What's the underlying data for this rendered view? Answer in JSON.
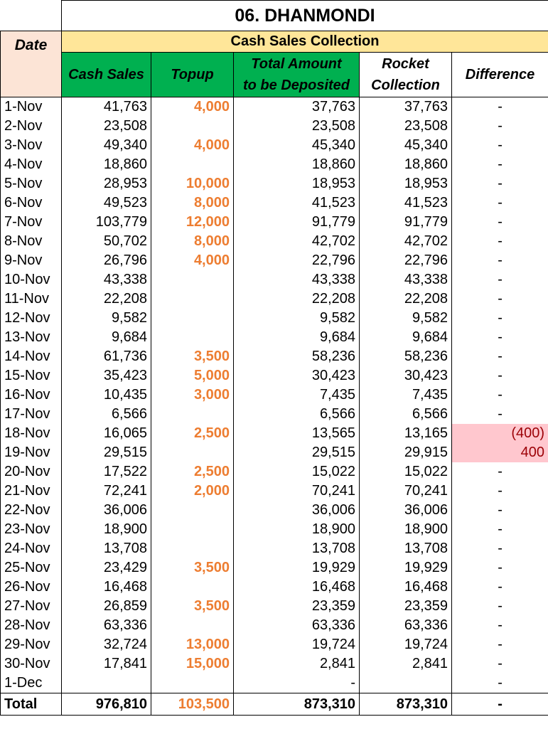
{
  "title": "06. DHANMONDI",
  "section_title": "Cash Sales Collection",
  "headers": {
    "date": "Date",
    "cash_sales": "Cash Sales",
    "topup": "Topup",
    "total_amount_line1": "Total Amount",
    "total_amount_line2": "to be Deposited",
    "rocket_line1": "Rocket",
    "rocket_line2": "Collection",
    "difference": "Difference"
  },
  "colors": {
    "banner": "#ffe699",
    "green_header": "#00b050",
    "date_header": "#fce4d6",
    "topup_text": "#ed7d31",
    "diff_highlight_bg": "#ffc7ce",
    "diff_highlight_text": "#9c0006"
  },
  "rows": [
    {
      "date": "1-Nov",
      "cash_sales": "41,763",
      "topup": "4,000",
      "total": "37,763",
      "rocket": "37,763",
      "difference": "-"
    },
    {
      "date": "2-Nov",
      "cash_sales": "23,508",
      "topup": "",
      "total": "23,508",
      "rocket": "23,508",
      "difference": "-"
    },
    {
      "date": "3-Nov",
      "cash_sales": "49,340",
      "topup": "4,000",
      "total": "45,340",
      "rocket": "45,340",
      "difference": "-"
    },
    {
      "date": "4-Nov",
      "cash_sales": "18,860",
      "topup": "",
      "total": "18,860",
      "rocket": "18,860",
      "difference": "-"
    },
    {
      "date": "5-Nov",
      "cash_sales": "28,953",
      "topup": "10,000",
      "total": "18,953",
      "rocket": "18,953",
      "difference": "-"
    },
    {
      "date": "6-Nov",
      "cash_sales": "49,523",
      "topup": "8,000",
      "total": "41,523",
      "rocket": "41,523",
      "difference": "-"
    },
    {
      "date": "7-Nov",
      "cash_sales": "103,779",
      "topup": "12,000",
      "total": "91,779",
      "rocket": "91,779",
      "difference": "-"
    },
    {
      "date": "8-Nov",
      "cash_sales": "50,702",
      "topup": "8,000",
      "total": "42,702",
      "rocket": "42,702",
      "difference": "-"
    },
    {
      "date": "9-Nov",
      "cash_sales": "26,796",
      "topup": "4,000",
      "total": "22,796",
      "rocket": "22,796",
      "difference": "-"
    },
    {
      "date": "10-Nov",
      "cash_sales": "43,338",
      "topup": "",
      "total": "43,338",
      "rocket": "43,338",
      "difference": "-"
    },
    {
      "date": "11-Nov",
      "cash_sales": "22,208",
      "topup": "",
      "total": "22,208",
      "rocket": "22,208",
      "difference": "-"
    },
    {
      "date": "12-Nov",
      "cash_sales": "9,582",
      "topup": "",
      "total": "9,582",
      "rocket": "9,582",
      "difference": "-"
    },
    {
      "date": "13-Nov",
      "cash_sales": "9,684",
      "topup": "",
      "total": "9,684",
      "rocket": "9,684",
      "difference": "-"
    },
    {
      "date": "14-Nov",
      "cash_sales": "61,736",
      "topup": "3,500",
      "total": "58,236",
      "rocket": "58,236",
      "difference": "-"
    },
    {
      "date": "15-Nov",
      "cash_sales": "35,423",
      "topup": "5,000",
      "total": "30,423",
      "rocket": "30,423",
      "difference": "-"
    },
    {
      "date": "16-Nov",
      "cash_sales": "10,435",
      "topup": "3,000",
      "total": "7,435",
      "rocket": "7,435",
      "difference": "-"
    },
    {
      "date": "17-Nov",
      "cash_sales": "6,566",
      "topup": "",
      "total": "6,566",
      "rocket": "6,566",
      "difference": "-"
    },
    {
      "date": "18-Nov",
      "cash_sales": "16,065",
      "topup": "2,500",
      "total": "13,565",
      "rocket": "13,165",
      "difference": "(400)",
      "flag": "neg"
    },
    {
      "date": "19-Nov",
      "cash_sales": "29,515",
      "topup": "",
      "total": "29,515",
      "rocket": "29,915",
      "difference": "400",
      "flag": "pos"
    },
    {
      "date": "20-Nov",
      "cash_sales": "17,522",
      "topup": "2,500",
      "total": "15,022",
      "rocket": "15,022",
      "difference": "-"
    },
    {
      "date": "21-Nov",
      "cash_sales": "72,241",
      "topup": "2,000",
      "total": "70,241",
      "rocket": "70,241",
      "difference": "-"
    },
    {
      "date": "22-Nov",
      "cash_sales": "36,006",
      "topup": "",
      "total": "36,006",
      "rocket": "36,006",
      "difference": "-"
    },
    {
      "date": "23-Nov",
      "cash_sales": "18,900",
      "topup": "",
      "total": "18,900",
      "rocket": "18,900",
      "difference": "-"
    },
    {
      "date": "24-Nov",
      "cash_sales": "13,708",
      "topup": "",
      "total": "13,708",
      "rocket": "13,708",
      "difference": "-"
    },
    {
      "date": "25-Nov",
      "cash_sales": "23,429",
      "topup": "3,500",
      "total": "19,929",
      "rocket": "19,929",
      "difference": "-"
    },
    {
      "date": "26-Nov",
      "cash_sales": "16,468",
      "topup": "",
      "total": "16,468",
      "rocket": "16,468",
      "difference": "-"
    },
    {
      "date": "27-Nov",
      "cash_sales": "26,859",
      "topup": "3,500",
      "total": "23,359",
      "rocket": "23,359",
      "difference": "-"
    },
    {
      "date": "28-Nov",
      "cash_sales": "63,336",
      "topup": "",
      "total": "63,336",
      "rocket": "63,336",
      "difference": "-"
    },
    {
      "date": "29-Nov",
      "cash_sales": "32,724",
      "topup": "13,000",
      "total": "19,724",
      "rocket": "19,724",
      "difference": "-"
    },
    {
      "date": "30-Nov",
      "cash_sales": "17,841",
      "topup": "15,000",
      "total": "2,841",
      "rocket": "2,841",
      "difference": "-"
    },
    {
      "date": "1-Dec",
      "cash_sales": "",
      "topup": "",
      "total": "-",
      "rocket": "",
      "difference": "-"
    }
  ],
  "totals": {
    "label": "Total",
    "cash_sales": "976,810",
    "topup": "103,500",
    "total": "873,310",
    "rocket": "873,310",
    "difference": "-"
  }
}
